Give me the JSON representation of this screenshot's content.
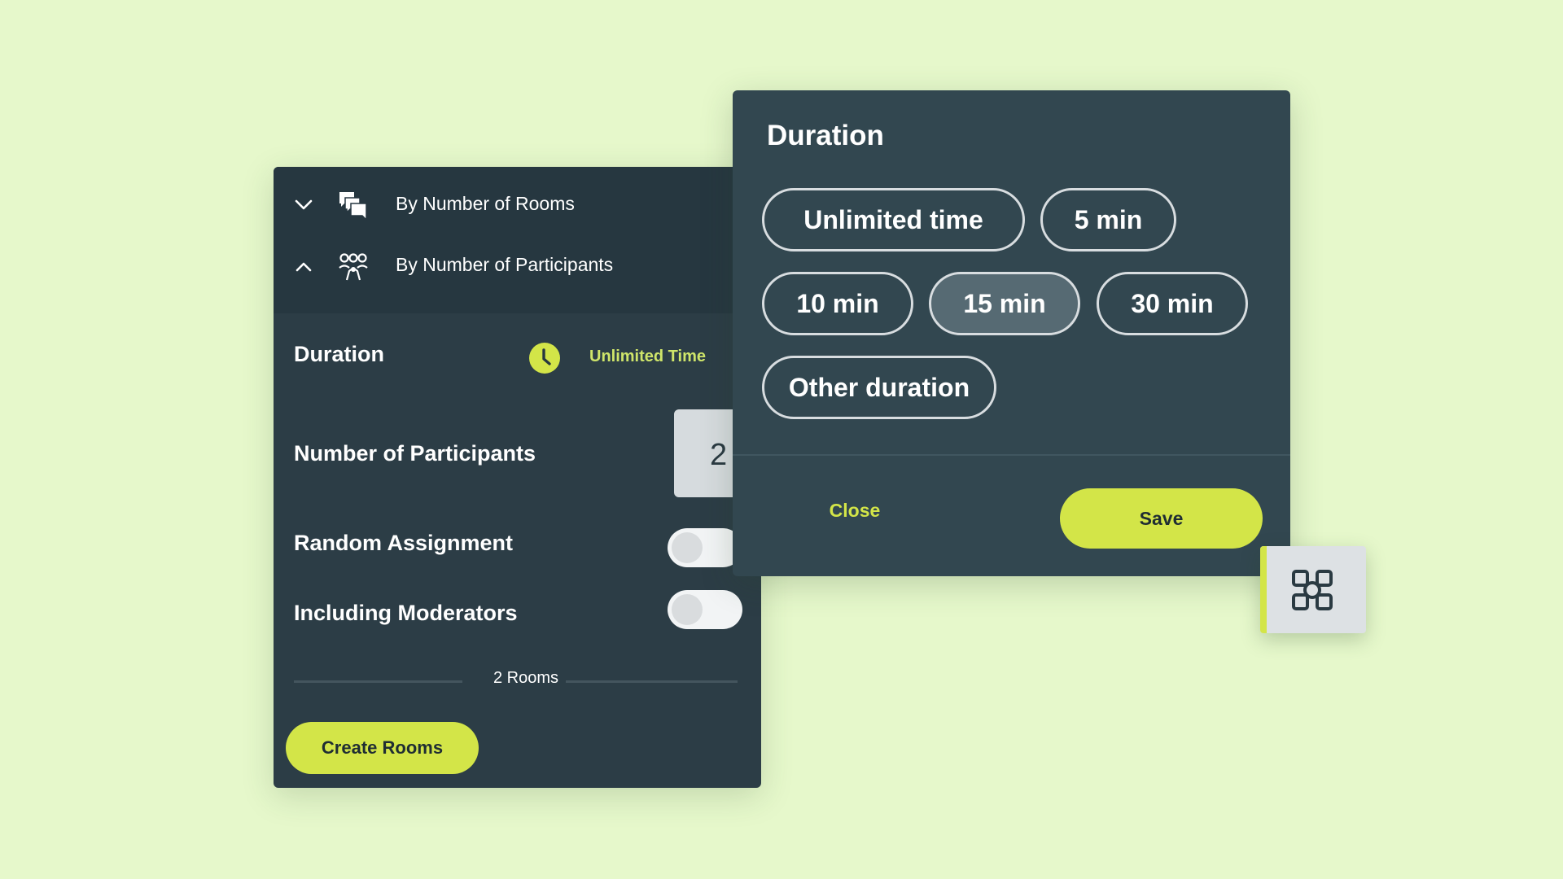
{
  "modes": {
    "by_rooms": "By Number of Rooms",
    "by_participants": "By Number of Participants"
  },
  "settings": {
    "duration_label": "Duration",
    "duration_value": "Unlimited Time",
    "participants_label": "Number of Participants",
    "participants_value": "2",
    "random_assignment_label": "Random Assignment",
    "random_assignment_on": false,
    "including_moderators_label": "Including Moderators",
    "including_moderators_on": false,
    "rooms_count": "2 Rooms",
    "create_button": "Create Rooms"
  },
  "duration_modal": {
    "title": "Duration",
    "options": [
      {
        "label": "Unlimited time",
        "selected": false
      },
      {
        "label": "5 min",
        "selected": false
      },
      {
        "label": "10 min",
        "selected": false
      },
      {
        "label": "15 min",
        "selected": true
      },
      {
        "label": "30 min",
        "selected": false
      },
      {
        "label": "Other duration",
        "selected": false
      }
    ],
    "close_button": "Close",
    "save_button": "Save"
  },
  "icons": {
    "collapse": "chevron-down-icon",
    "expand": "chevron-up-icon",
    "rooms": "chat-bubbles-icon",
    "participants": "group-icon",
    "clock": "clock-icon",
    "widget": "breakout-rooms-icon"
  },
  "colors": {
    "background": "#e6f8cb",
    "panel": "#2c3d46",
    "modal": "#324750",
    "accent": "#d3e548",
    "selected_pill": "#566a73"
  }
}
